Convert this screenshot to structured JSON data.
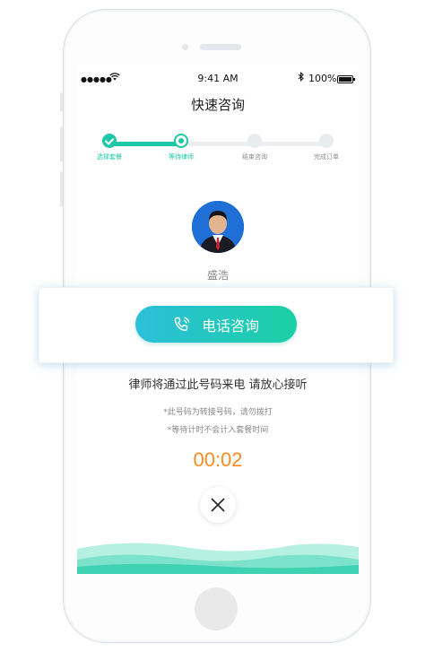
{
  "status_bar": {
    "signal": "●●●●●",
    "time": "9:41 AM",
    "battery": "100%"
  },
  "nav": {
    "title": "快速咨询"
  },
  "steps": [
    {
      "label": "选择套餐",
      "state": "done"
    },
    {
      "label": "等待律师",
      "state": "current"
    },
    {
      "label": "结束咨询",
      "state": "pending"
    },
    {
      "label": "完成订单",
      "state": "pending"
    }
  ],
  "lawyer": {
    "name": "盛浩"
  },
  "call": {
    "button_label": "电话咨询"
  },
  "notice": "律师将通过此号码来电 请放心接听",
  "hints": [
    "*此号码为转接号码，请勿拨打",
    "*等待计时不会计入套餐时间"
  ],
  "timer": "00:02",
  "colors": {
    "accent": "#1cc8a5",
    "gradient_start": "#2bbfd9",
    "gradient_end": "#1ad0a4",
    "timer": "#ff8a1f"
  }
}
